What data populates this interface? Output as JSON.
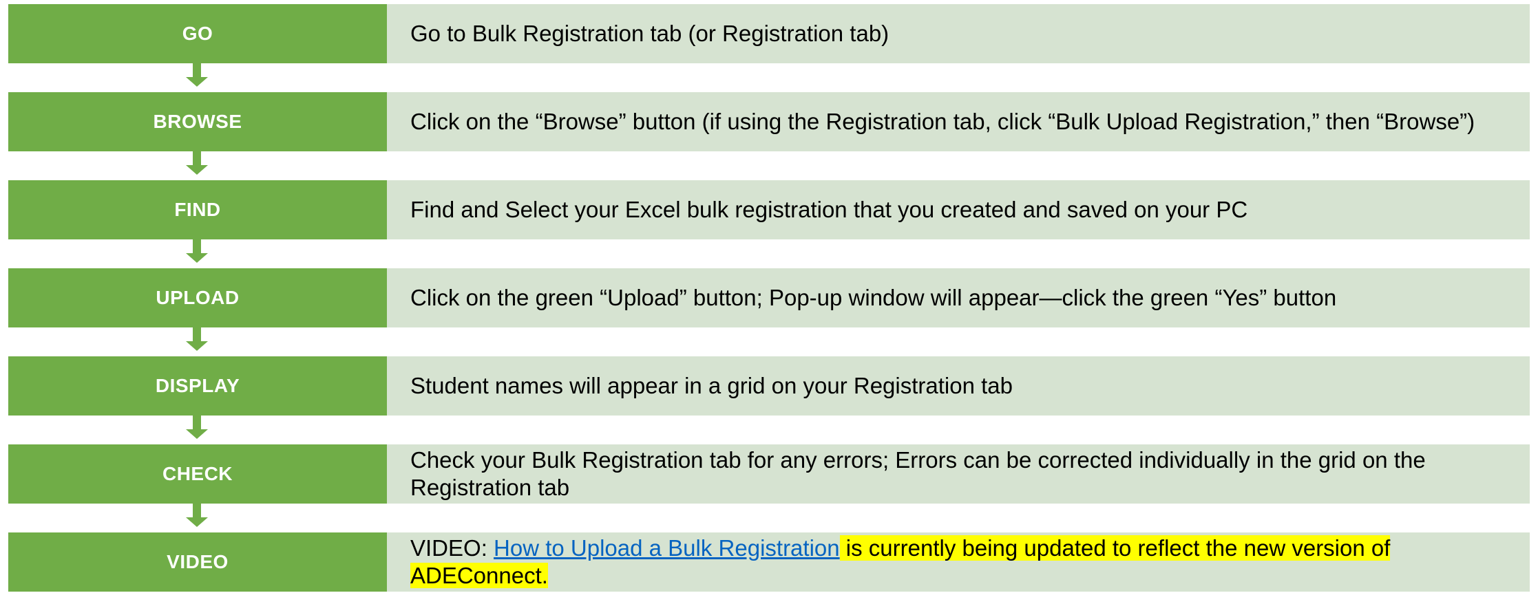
{
  "steps": [
    {
      "label": "GO",
      "text": "Go to Bulk Registration tab (or Registration tab)"
    },
    {
      "label": "BROWSE",
      "text": "Click on the “Browse” button (if using the Registration tab, click “Bulk Upload Registration,” then “Browse”)"
    },
    {
      "label": "FIND",
      "text": "Find and Select your Excel bulk registration that you created and saved on your PC"
    },
    {
      "label": "UPLOAD",
      "text": "Click on the green “Upload” button; Pop-up window will appear—click the green “Yes” button"
    },
    {
      "label": "DISPLAY",
      "text": "Student names will appear in a grid on your Registration tab"
    },
    {
      "label": "CHECK",
      "text": "Check your Bulk Registration tab for any errors; Errors can be corrected individually in the grid on the Registration tab"
    },
    {
      "label": "VIDEO",
      "prefix": "VIDEO: ",
      "link_text": "How to Upload a Bulk Registration",
      "highlight_text": " is currently being updated to reflect the new version of ADEConnect."
    }
  ],
  "colors": {
    "label_fill": "#70ad47",
    "description_fill": "#d6e3d1",
    "link": "#0563c1",
    "highlight": "#ffff00"
  }
}
